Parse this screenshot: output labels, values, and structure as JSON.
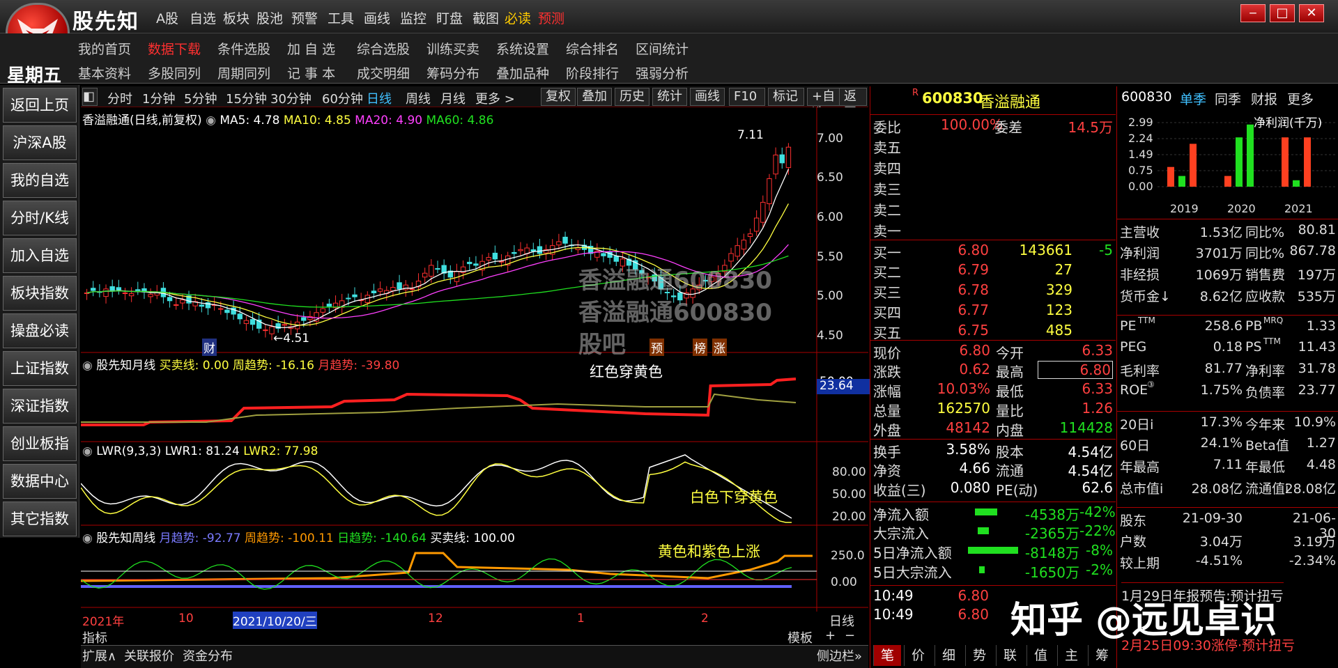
{
  "app": {
    "name": "股先知",
    "weekday": "星期五"
  },
  "top_menu": [
    "A股",
    "自选",
    "板块",
    "股池",
    "预警",
    "工具",
    "画线",
    "监控",
    "盯盘",
    "截图",
    "必读",
    "预测"
  ],
  "nav1": [
    "我的首页",
    "数据下载",
    "条件选股",
    "加 自 选",
    "综合选股",
    "训练买卖",
    "系统设置",
    "综合排名",
    "区间统计"
  ],
  "nav2": [
    "基本资料",
    "多股同列",
    "周期同列",
    "记 事 本",
    "成交明细",
    "筹码分布",
    "叠加品种",
    "阶段排行",
    "强弱分析"
  ],
  "sidebar": [
    "返回上页",
    "沪深A股",
    "我的自选",
    "分时/K线",
    "加入自选",
    "板块指数",
    "操盘必读",
    "上证指数",
    "深证指数",
    "创业板指",
    "数据中心",
    "其它指数"
  ],
  "toolbar": {
    "periods": [
      "分时",
      "1分钟",
      "5分钟",
      "15分钟",
      "30分钟",
      "60分钟",
      "日线",
      "周线",
      "月线",
      "更多 >"
    ],
    "buttons": [
      "复权",
      "叠加",
      "历史",
      "统计",
      "画线",
      "F10",
      "标记",
      "+自选",
      "返回"
    ]
  },
  "main_chart": {
    "legend": {
      "title": "香溢融通(日线,前复权)",
      "ma5": "MA5: 4.78",
      "ma10": "MA10: 4.85",
      "ma20": "MA20: 4.90",
      "ma60": "MA60: 4.86"
    },
    "y_ticks": [
      "7.00",
      "6.50",
      "6.00",
      "5.50",
      "5.00",
      "4.50"
    ],
    "high_label": "7.11",
    "low_label": "4.51",
    "markers": [
      "财",
      "预",
      "榜",
      "涨"
    ]
  },
  "chart_data": [
    {
      "type": "candlestick",
      "title": "香溢融通(日线,前复权)",
      "y_ticks": [
        7.0,
        6.5,
        6.0,
        5.5,
        5.0,
        4.5
      ],
      "ylim": [
        4.4,
        7.3
      ],
      "high": 7.11,
      "low": 4.51,
      "ma": {
        "MA5": 4.78,
        "MA10": 4.85,
        "MA20": 4.9,
        "MA60": 4.86
      },
      "close": [
        5.05,
        5.08,
        5.06,
        5.1,
        5.07,
        5.09,
        5.05,
        5.04,
        5.08,
        5.06,
        5.03,
        5.05,
        5.0,
        4.95,
        4.9,
        4.96,
        4.92,
        4.94,
        4.88,
        4.86,
        4.9,
        4.85,
        4.8,
        4.78,
        4.72,
        4.7,
        4.65,
        4.6,
        4.58,
        4.62,
        4.6,
        4.65,
        4.62,
        4.68,
        4.7,
        4.75,
        4.8,
        4.85,
        4.88,
        4.92,
        4.95,
        4.98,
        5.0,
        4.96,
        5.02,
        5.05,
        5.1,
        5.08,
        5.12,
        5.1,
        5.15,
        5.1,
        5.2,
        5.3,
        5.4,
        5.35,
        5.3,
        5.25,
        5.32,
        5.38,
        5.42,
        5.4,
        5.45,
        5.5,
        5.48,
        5.45,
        5.52,
        5.55,
        5.6,
        5.62,
        5.58,
        5.55,
        5.6,
        5.65,
        5.7,
        5.68,
        5.65,
        5.62,
        5.6,
        5.55,
        5.58,
        5.52,
        5.5,
        5.45,
        5.48,
        5.4,
        5.35,
        5.3,
        5.25,
        5.2,
        5.1,
        5.05,
        5.0,
        4.96,
        5.05,
        5.1,
        5.15,
        5.2,
        5.25,
        5.3,
        5.4,
        5.55,
        5.65,
        5.72,
        5.8,
        6.0,
        6.2,
        6.5,
        6.8,
        6.7,
        6.9
      ]
    },
    {
      "type": "line",
      "title": "股先知月线",
      "series": [
        {
          "name": "买卖线",
          "last": 0.0
        },
        {
          "name": "周趋势",
          "last": -16.16
        },
        {
          "name": "月趋势",
          "last": -39.8
        }
      ],
      "y_ticks": [
        50.0
      ],
      "value_box": 23.64
    },
    {
      "type": "line",
      "title": "LWR(9,3,3)",
      "series": [
        {
          "name": "LWR1",
          "last": 81.24
        },
        {
          "name": "LWR2",
          "last": 77.98
        }
      ],
      "y_ticks": [
        80.0,
        50.0,
        20.0
      ]
    },
    {
      "type": "line",
      "title": "股先知周线",
      "series": [
        {
          "name": "月趋势",
          "last": -92.77
        },
        {
          "name": "周趋势",
          "last": -100.11
        },
        {
          "name": "日趋势",
          "last": -140.64
        },
        {
          "name": "买卖线",
          "last": 100.0
        }
      ],
      "y_ticks": [
        250.0,
        0.0
      ]
    }
  ],
  "panels": {
    "p2": {
      "title": "股先知月线",
      "l1": "买卖线: 0.00",
      "l2": "周趋势: -16.16",
      "l3": "月趋势: -39.80",
      "value_box": "23.64",
      "y": "50.00",
      "note": "红色穿黄色"
    },
    "p3": {
      "title": "LWR(9,3,3)",
      "l1": "LWR1: 81.24",
      "l2": "LWR2: 77.98",
      "y1": "80.00",
      "y2": "50.00",
      "y3": "20.00",
      "note": "白色下穿黄色"
    },
    "p4": {
      "title": "股先知周线",
      "l1": "月趋势: -92.77",
      "l2": "周趋势: -100.11",
      "l3": "日趋势: -140.64",
      "l4": "买卖线: 100.00",
      "y1": "250.0",
      "y2": "0.00",
      "note": "黄色和紫色上涨"
    }
  },
  "time_axis": {
    "labels": [
      "2021年",
      "10",
      "2021/10/20/三",
      "12",
      "1",
      "2"
    ],
    "period": "日线"
  },
  "bottom": {
    "left": [
      "指标",
      "扩展∧",
      "关联报价",
      "资金分布"
    ],
    "right": [
      "模板",
      "+",
      "−",
      "侧边栏»"
    ]
  },
  "overlay": "香溢融通600830 香溢融通600830股吧",
  "quote": {
    "code": "600830",
    "name": "香溢融通",
    "weibi": {
      "label": "委比",
      "value": "100.00%",
      "label2": "委差",
      "value2": "14.5万"
    },
    "sells": [
      "卖五",
      "卖四",
      "卖三",
      "卖二",
      "卖一"
    ],
    "buys": [
      {
        "l": "买一",
        "p": "6.80",
        "v": "143661",
        "c": "-5"
      },
      {
        "l": "买二",
        "p": "6.79",
        "v": "27",
        "c": ""
      },
      {
        "l": "买三",
        "p": "6.78",
        "v": "329",
        "c": ""
      },
      {
        "l": "买四",
        "p": "6.77",
        "v": "123",
        "c": ""
      },
      {
        "l": "买五",
        "p": "6.75",
        "v": "485",
        "c": ""
      }
    ],
    "stats": [
      {
        "a": "现价",
        "av": "6.80",
        "b": "今开",
        "bv": "6.33"
      },
      {
        "a": "涨跌",
        "av": "0.62",
        "b": "最高",
        "bv": "6.80"
      },
      {
        "a": "涨幅",
        "av": "10.03%",
        "b": "最低",
        "bv": "6.33"
      },
      {
        "a": "总量",
        "av": "162570",
        "b": "量比",
        "bv": "1.26"
      },
      {
        "a": "外盘",
        "av": "48142",
        "b": "内盘",
        "bv": "114428"
      }
    ],
    "stats2": [
      {
        "a": "换手",
        "av": "3.58%",
        "b": "股本",
        "bv": "4.54亿"
      },
      {
        "a": "净资",
        "av": "4.66",
        "b": "流通",
        "bv": "4.54亿"
      },
      {
        "a": "收益(三)",
        "av": "0.080",
        "b": "PE(动)",
        "bv": "62.6"
      }
    ],
    "flows": [
      {
        "l": "净流入额",
        "v": "-4538万",
        "p": "-42%",
        "w": 0.4
      },
      {
        "l": "大宗流入",
        "v": "-2365万",
        "p": "-22%",
        "w": 0.2
      },
      {
        "l": "5日净流入额",
        "v": "-8148万",
        "p": "-8%",
        "w": 0.9
      },
      {
        "l": "5日大宗流入",
        "v": "-1650万",
        "p": "-2%",
        "w": 0.1
      }
    ],
    "ticks": [
      {
        "t": "10:49",
        "p": "6.80"
      },
      {
        "t": "10:49",
        "p": "6.80"
      }
    ],
    "tabs": [
      "笔",
      "价",
      "细",
      "势",
      "联",
      "值",
      "主",
      "筹"
    ]
  },
  "right": {
    "code": "600830",
    "tabs": [
      "单季",
      "同季",
      "财报",
      "更多"
    ],
    "profit_chart": {
      "title": "净利润(千万)",
      "y": [
        "2.99",
        "2.24",
        "1.49",
        "0.75",
        "0.00"
      ],
      "years": [
        "2019",
        "2020",
        "2021"
      ],
      "bars": [
        {
          "c": "#ff4020",
          "v": 0.92
        },
        {
          "c": "#20e020",
          "v": 0.5
        },
        {
          "c": "#ff4020",
          "v": 2.0
        },
        {
          "c": "#ff4020",
          "v": 0.5
        },
        {
          "c": "#20e020",
          "v": 2.3
        },
        {
          "c": "#20e020",
          "v": 2.9
        },
        {
          "c": "#ff4020",
          "v": 2.3
        },
        {
          "c": "#20e020",
          "v": 0.3
        },
        {
          "c": "#ff4020",
          "v": 2.3
        }
      ]
    },
    "fin": [
      {
        "a": "主营收",
        "av": "1.53亿",
        "b": "同比%",
        "bv": "80.81"
      },
      {
        "a": "净利润",
        "av": "3701万",
        "b": "同比%",
        "bv": "867.78"
      },
      {
        "a": "非经损",
        "av": "1069万",
        "b": "销售费",
        "bv": "197万"
      },
      {
        "a": "货币金↓",
        "av": "8.62亿",
        "b": "应收款",
        "bv": "535万"
      }
    ],
    "ratios": [
      {
        "a": "PE",
        "sup": "TTM",
        "av": "258.6",
        "b": "PB",
        "bsup": "MRQ",
        "bv": "1.33"
      },
      {
        "a": "PEG",
        "sup": "",
        "av": "0.18",
        "b": "PS",
        "bsup": "TTM",
        "bv": "11.43"
      },
      {
        "a": "毛利率",
        "sup": "",
        "av": "81.77",
        "b": "净利率",
        "bsup": "",
        "bv": "31.78"
      },
      {
        "a": "ROE",
        "sup": "③",
        "av": "1.75%",
        "b": "负债率",
        "bsup": "",
        "bv": "23.77"
      }
    ],
    "perf": [
      {
        "a": "20日i",
        "av": "17.3%",
        "b": "今年来",
        "bv": "10.9%"
      },
      {
        "a": "60日",
        "av": "24.1%",
        "b": "Beta值",
        "bv": "1.27"
      },
      {
        "a": "年最高",
        "av": "7.11",
        "b": "年最低",
        "bv": "4.48"
      },
      {
        "a": "总市值i",
        "av": "28.08亿",
        "b": "流通值i",
        "bv": "28.08亿"
      }
    ],
    "holders": [
      {
        "a": "股东",
        "av": "21-09-30",
        "bv": "21-06-30"
      },
      {
        "a": "户数",
        "av": "3.04万",
        "bv": "3.19万"
      },
      {
        "a": "较上期",
        "av": "-4.51%",
        "bv": "-2.34%"
      }
    ],
    "news": [
      "1月29日年报预告:预计扭亏",
      "2月25日09:30涨停·预计扭亏"
    ]
  },
  "watermark": "知乎 @远见卓识"
}
